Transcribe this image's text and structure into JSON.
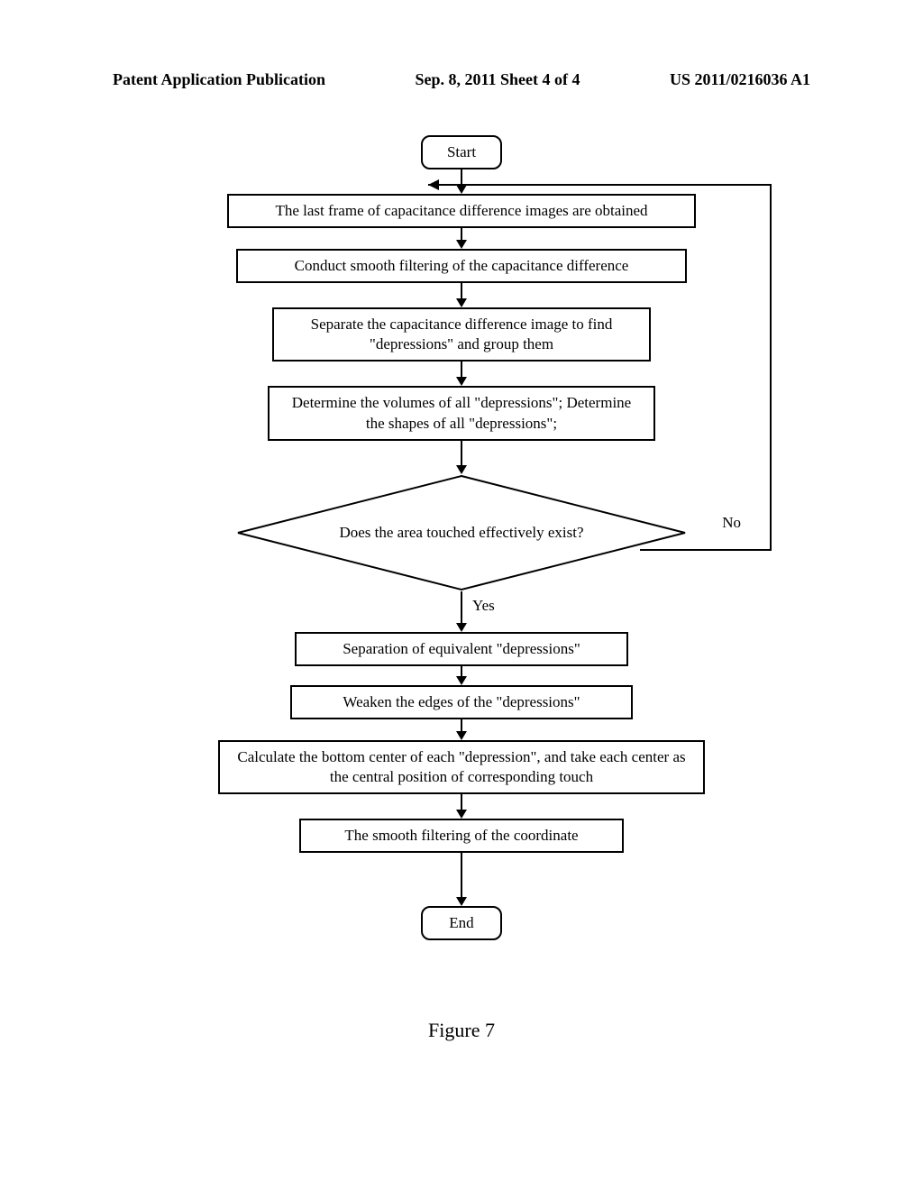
{
  "header": {
    "left": "Patent Application Publication",
    "center": "Sep. 8, 2011   Sheet 4 of 4",
    "right": "US 2011/0216036 A1"
  },
  "flow": {
    "start": "Start",
    "step1": "The last frame of capacitance difference images are obtained",
    "step2": "Conduct smooth filtering of the capacitance difference",
    "step3": "Separate the capacitance difference image to find \"depressions\" and group them",
    "step4": "Determine the volumes of all \"depressions\"; Determine the shapes of all \"depressions\";",
    "decision": "Does the area touched effectively exist?",
    "yes": "Yes",
    "no": "No",
    "step5": "Separation of equivalent \"depressions\"",
    "step6": "Weaken the edges of the \"depressions\"",
    "step7": "Calculate the bottom center of each \"depression\", and take each center as the central position of corresponding touch",
    "step8": "The smooth filtering of the coordinate",
    "end": "End"
  },
  "caption": "Figure 7"
}
